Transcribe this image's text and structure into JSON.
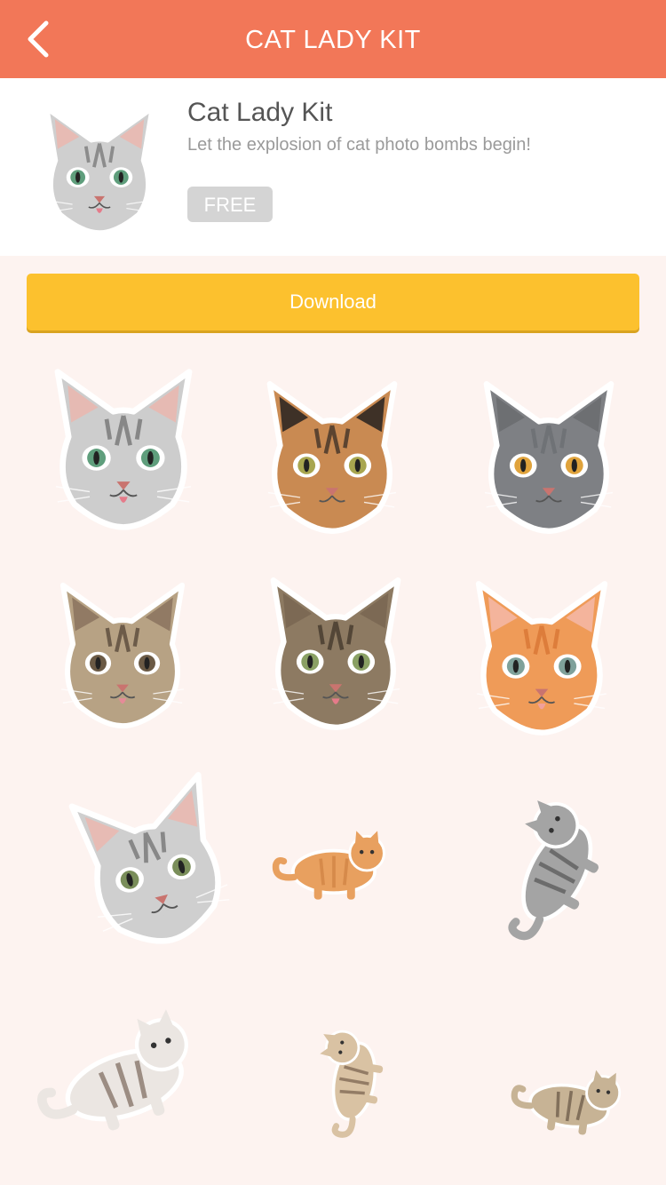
{
  "header": {
    "title": "CAT LADY KIT",
    "back_icon": "chevron-left-icon"
  },
  "kit": {
    "name": "Cat Lady Kit",
    "description": "Let the explosion of cat photo bombs begin!",
    "price_label": "FREE"
  },
  "actions": {
    "download_label": "Download"
  },
  "colors": {
    "header_bg": "#f27758",
    "download_bg": "#fcc12e",
    "badge_bg": "#d4d4d4",
    "grid_bg": "#fdf3f0"
  },
  "stickers": [
    "silver-tabby-head",
    "calico-head",
    "gray-cat-head",
    "yawning-tabby-head",
    "tabby-tongue-head",
    "orange-kitten-head",
    "tilted-tabby-head",
    "lying-orange-cat",
    "standing-tabby-cat",
    "siamese-rolling-cat",
    "siamese-sitting-cat",
    "tabby-lying-on-back"
  ]
}
